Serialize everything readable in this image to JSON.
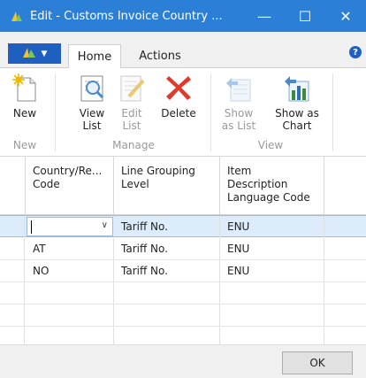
{
  "window": {
    "title": "Edit - Customs Invoice Country ...",
    "controls": {
      "minimize": "—",
      "maximize": "☐",
      "close": "✕"
    }
  },
  "ribbon": {
    "tabs": [
      {
        "label": "Home",
        "active": true
      },
      {
        "label": "Actions",
        "active": false
      }
    ],
    "help_label": "?",
    "groups": [
      {
        "label": "New",
        "buttons": [
          {
            "label": "New",
            "icon": "new-document-icon",
            "enabled": true
          }
        ]
      },
      {
        "label": "Manage",
        "buttons": [
          {
            "label": "View List",
            "line1": "View",
            "line2": "List",
            "icon": "view-list-icon",
            "enabled": true
          },
          {
            "label": "Edit List",
            "line1": "Edit",
            "line2": "List",
            "icon": "edit-list-icon",
            "enabled": false
          },
          {
            "label": "Delete",
            "icon": "delete-icon",
            "enabled": true
          }
        ]
      },
      {
        "label": "View",
        "buttons": [
          {
            "label": "Show as List",
            "line1": "Show",
            "line2": "as List",
            "icon": "show-as-list-icon",
            "enabled": false
          },
          {
            "label": "Show as Chart",
            "line1": "Show as",
            "line2": "Chart",
            "icon": "show-as-chart-icon",
            "enabled": true
          }
        ]
      }
    ]
  },
  "grid": {
    "columns": [
      {
        "line1": "Country/Re...",
        "line2": "Code",
        "line3": ""
      },
      {
        "line1": "Line Grouping",
        "line2": "Level",
        "line3": ""
      },
      {
        "line1": "Item",
        "line2": "Description",
        "line3": "Language Code"
      }
    ],
    "rows": [
      {
        "country": "",
        "line_grouping": "Tariff No.",
        "language": "ENU",
        "selected": true
      },
      {
        "country": "AT",
        "line_grouping": "Tariff No.",
        "language": "ENU",
        "selected": false
      },
      {
        "country": "NO",
        "line_grouping": "Tariff No.",
        "language": "ENU",
        "selected": false
      }
    ],
    "dropdown_glyph": "∨"
  },
  "footer": {
    "ok_label": "OK"
  },
  "colors": {
    "titlebar": "#2c7fd6",
    "app_button": "#1e5fbf",
    "selected_row": "#ddecfa",
    "delete_red": "#e03a2f"
  }
}
